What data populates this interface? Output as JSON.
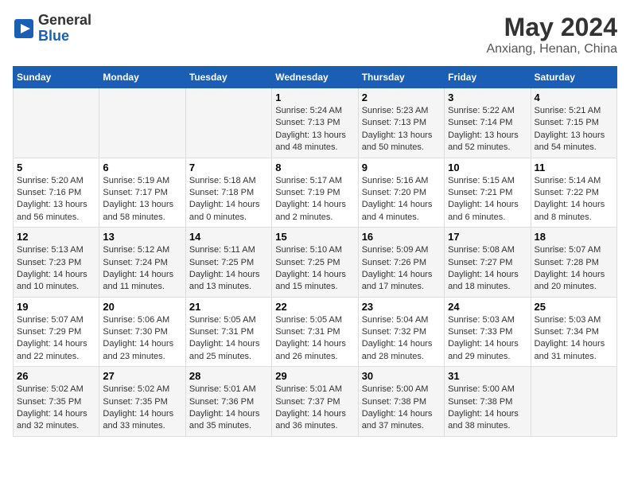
{
  "header": {
    "logo_line1": "General",
    "logo_line2": "Blue",
    "title": "May 2024",
    "subtitle": "Anxiang, Henan, China"
  },
  "days_of_week": [
    "Sunday",
    "Monday",
    "Tuesday",
    "Wednesday",
    "Thursday",
    "Friday",
    "Saturday"
  ],
  "weeks": [
    [
      {
        "num": "",
        "info": ""
      },
      {
        "num": "",
        "info": ""
      },
      {
        "num": "",
        "info": ""
      },
      {
        "num": "1",
        "info": "Sunrise: 5:24 AM\nSunset: 7:13 PM\nDaylight: 13 hours\nand 48 minutes."
      },
      {
        "num": "2",
        "info": "Sunrise: 5:23 AM\nSunset: 7:13 PM\nDaylight: 13 hours\nand 50 minutes."
      },
      {
        "num": "3",
        "info": "Sunrise: 5:22 AM\nSunset: 7:14 PM\nDaylight: 13 hours\nand 52 minutes."
      },
      {
        "num": "4",
        "info": "Sunrise: 5:21 AM\nSunset: 7:15 PM\nDaylight: 13 hours\nand 54 minutes."
      }
    ],
    [
      {
        "num": "5",
        "info": "Sunrise: 5:20 AM\nSunset: 7:16 PM\nDaylight: 13 hours\nand 56 minutes."
      },
      {
        "num": "6",
        "info": "Sunrise: 5:19 AM\nSunset: 7:17 PM\nDaylight: 13 hours\nand 58 minutes."
      },
      {
        "num": "7",
        "info": "Sunrise: 5:18 AM\nSunset: 7:18 PM\nDaylight: 14 hours\nand 0 minutes."
      },
      {
        "num": "8",
        "info": "Sunrise: 5:17 AM\nSunset: 7:19 PM\nDaylight: 14 hours\nand 2 minutes."
      },
      {
        "num": "9",
        "info": "Sunrise: 5:16 AM\nSunset: 7:20 PM\nDaylight: 14 hours\nand 4 minutes."
      },
      {
        "num": "10",
        "info": "Sunrise: 5:15 AM\nSunset: 7:21 PM\nDaylight: 14 hours\nand 6 minutes."
      },
      {
        "num": "11",
        "info": "Sunrise: 5:14 AM\nSunset: 7:22 PM\nDaylight: 14 hours\nand 8 minutes."
      }
    ],
    [
      {
        "num": "12",
        "info": "Sunrise: 5:13 AM\nSunset: 7:23 PM\nDaylight: 14 hours\nand 10 minutes."
      },
      {
        "num": "13",
        "info": "Sunrise: 5:12 AM\nSunset: 7:24 PM\nDaylight: 14 hours\nand 11 minutes."
      },
      {
        "num": "14",
        "info": "Sunrise: 5:11 AM\nSunset: 7:25 PM\nDaylight: 14 hours\nand 13 minutes."
      },
      {
        "num": "15",
        "info": "Sunrise: 5:10 AM\nSunset: 7:25 PM\nDaylight: 14 hours\nand 15 minutes."
      },
      {
        "num": "16",
        "info": "Sunrise: 5:09 AM\nSunset: 7:26 PM\nDaylight: 14 hours\nand 17 minutes."
      },
      {
        "num": "17",
        "info": "Sunrise: 5:08 AM\nSunset: 7:27 PM\nDaylight: 14 hours\nand 18 minutes."
      },
      {
        "num": "18",
        "info": "Sunrise: 5:07 AM\nSunset: 7:28 PM\nDaylight: 14 hours\nand 20 minutes."
      }
    ],
    [
      {
        "num": "19",
        "info": "Sunrise: 5:07 AM\nSunset: 7:29 PM\nDaylight: 14 hours\nand 22 minutes."
      },
      {
        "num": "20",
        "info": "Sunrise: 5:06 AM\nSunset: 7:30 PM\nDaylight: 14 hours\nand 23 minutes."
      },
      {
        "num": "21",
        "info": "Sunrise: 5:05 AM\nSunset: 7:31 PM\nDaylight: 14 hours\nand 25 minutes."
      },
      {
        "num": "22",
        "info": "Sunrise: 5:05 AM\nSunset: 7:31 PM\nDaylight: 14 hours\nand 26 minutes."
      },
      {
        "num": "23",
        "info": "Sunrise: 5:04 AM\nSunset: 7:32 PM\nDaylight: 14 hours\nand 28 minutes."
      },
      {
        "num": "24",
        "info": "Sunrise: 5:03 AM\nSunset: 7:33 PM\nDaylight: 14 hours\nand 29 minutes."
      },
      {
        "num": "25",
        "info": "Sunrise: 5:03 AM\nSunset: 7:34 PM\nDaylight: 14 hours\nand 31 minutes."
      }
    ],
    [
      {
        "num": "26",
        "info": "Sunrise: 5:02 AM\nSunset: 7:35 PM\nDaylight: 14 hours\nand 32 minutes."
      },
      {
        "num": "27",
        "info": "Sunrise: 5:02 AM\nSunset: 7:35 PM\nDaylight: 14 hours\nand 33 minutes."
      },
      {
        "num": "28",
        "info": "Sunrise: 5:01 AM\nSunset: 7:36 PM\nDaylight: 14 hours\nand 35 minutes."
      },
      {
        "num": "29",
        "info": "Sunrise: 5:01 AM\nSunset: 7:37 PM\nDaylight: 14 hours\nand 36 minutes."
      },
      {
        "num": "30",
        "info": "Sunrise: 5:00 AM\nSunset: 7:38 PM\nDaylight: 14 hours\nand 37 minutes."
      },
      {
        "num": "31",
        "info": "Sunrise: 5:00 AM\nSunset: 7:38 PM\nDaylight: 14 hours\nand 38 minutes."
      },
      {
        "num": "",
        "info": ""
      }
    ]
  ]
}
